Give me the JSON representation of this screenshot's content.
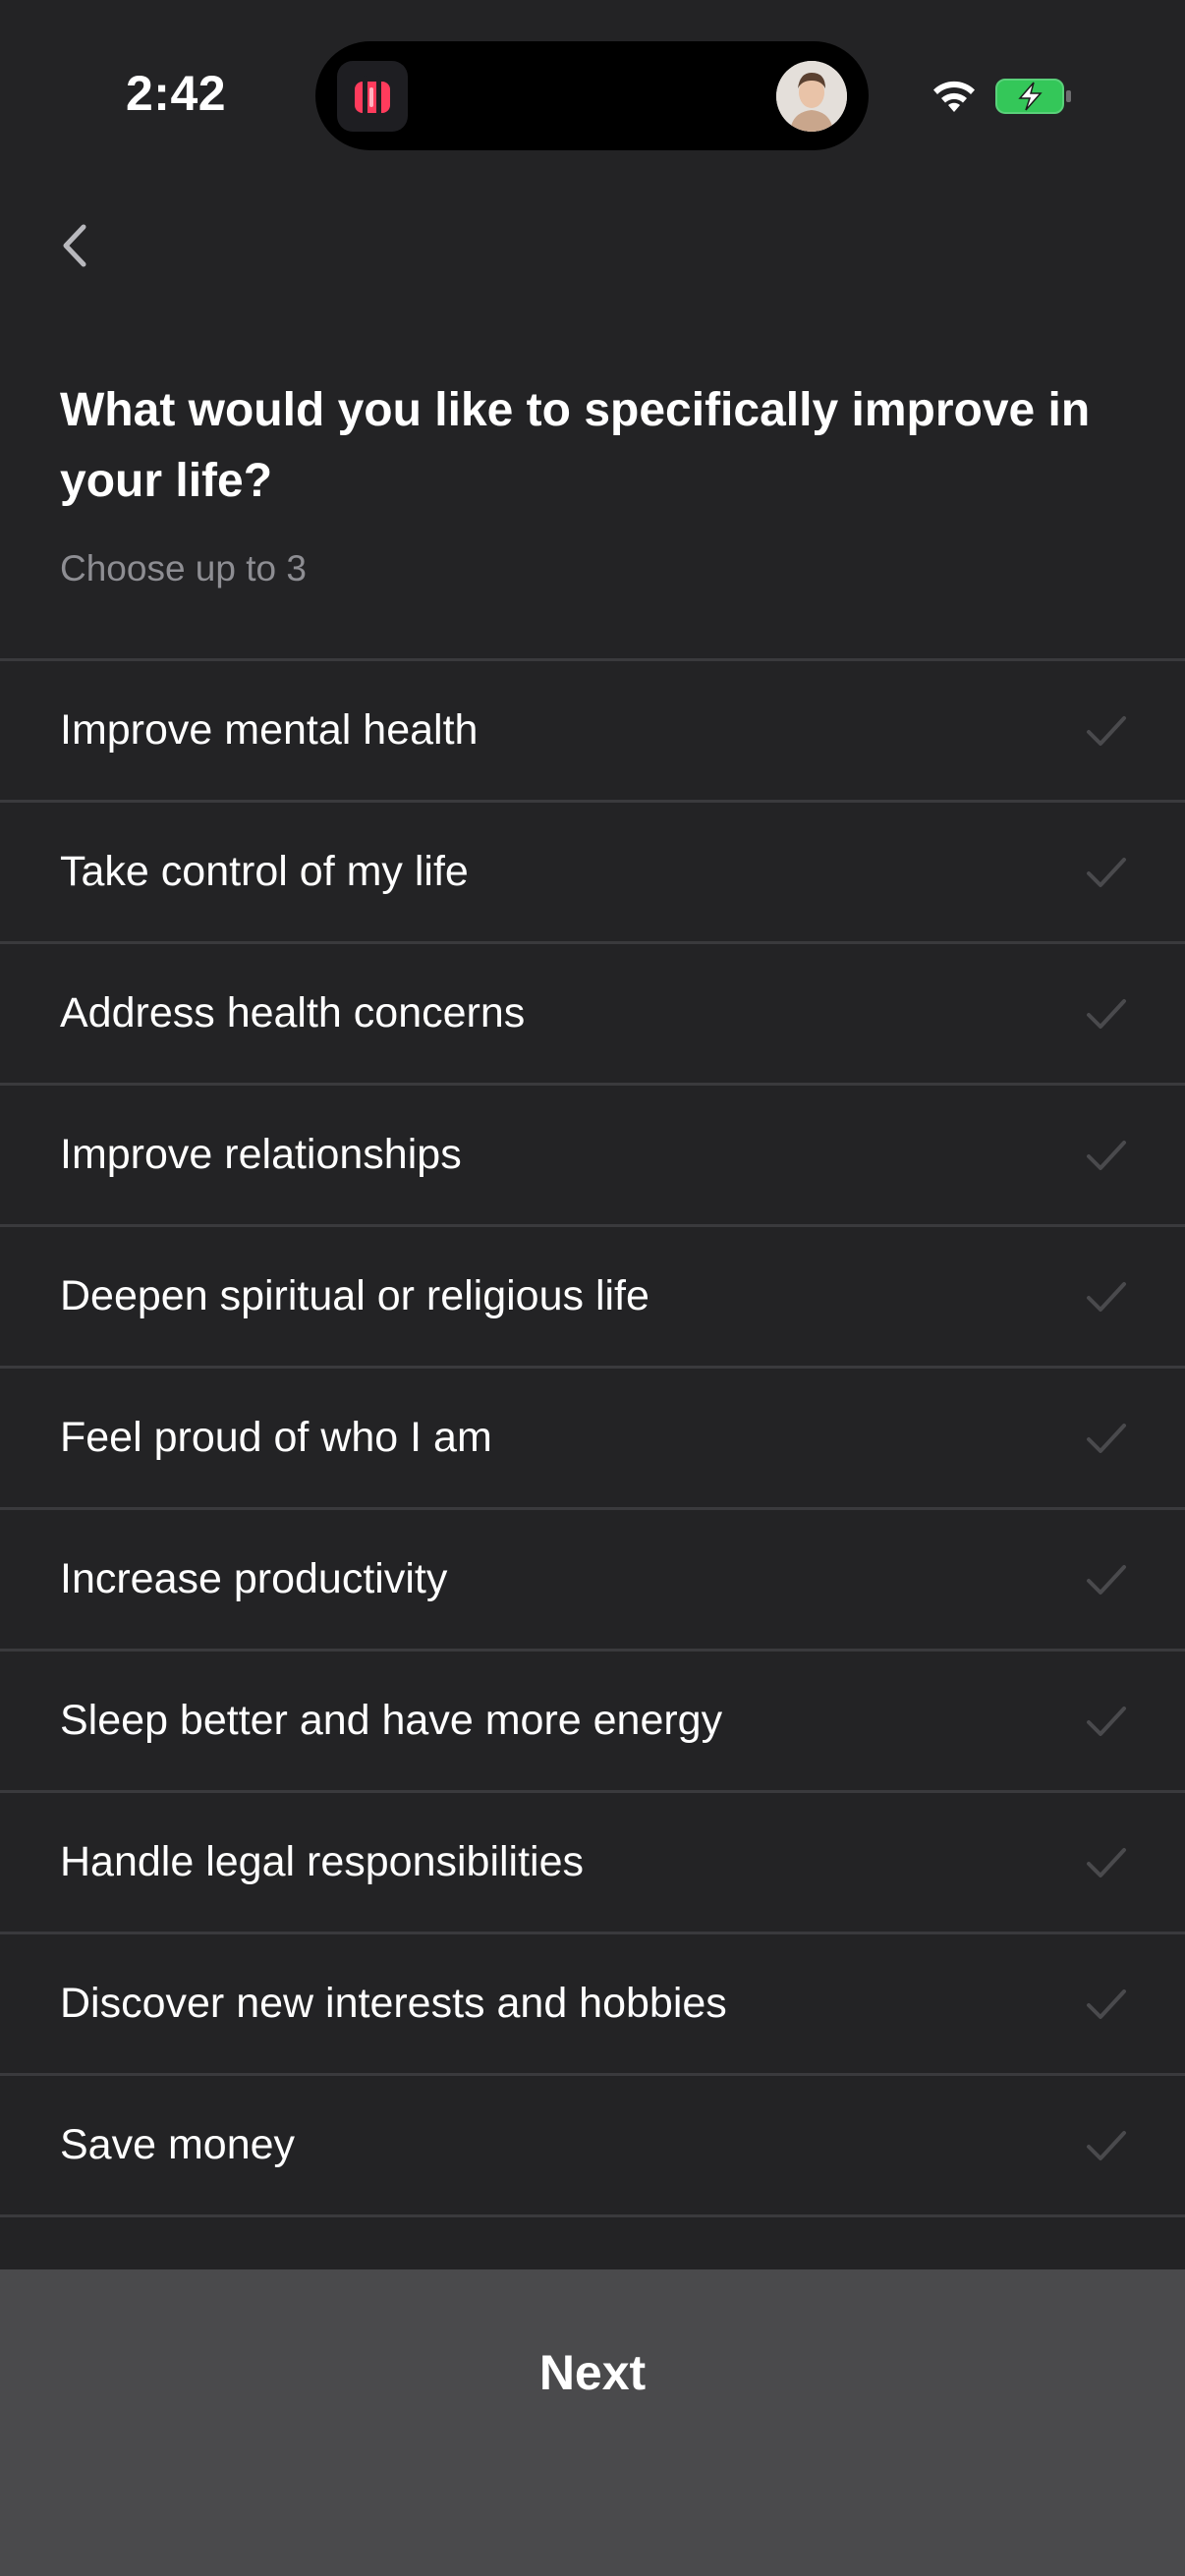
{
  "status_bar": {
    "time": "2:42"
  },
  "header": {
    "title": "What would you like to specifically improve in your life?",
    "subtitle": "Choose up to 3"
  },
  "options": [
    {
      "label": "Improve mental health"
    },
    {
      "label": "Take control of my life"
    },
    {
      "label": "Address health concerns"
    },
    {
      "label": "Improve relationships"
    },
    {
      "label": "Deepen spiritual or religious life"
    },
    {
      "label": "Feel proud of who I am"
    },
    {
      "label": "Increase productivity"
    },
    {
      "label": "Sleep better and have more energy"
    },
    {
      "label": "Handle legal responsibilities"
    },
    {
      "label": "Discover new interests and hobbies"
    },
    {
      "label": "Save money"
    }
  ],
  "footer": {
    "next_label": "Next"
  },
  "colors": {
    "background": "#232325",
    "divider": "#3a3a3d",
    "muted_text": "#8e8e93",
    "check_unselected": "#4a4a4d",
    "next_button_bg": "#4a4a4c",
    "battery_green": "#34c759",
    "app_icon_accent": "#ff3b5c"
  },
  "icons": {
    "back": "chevron-left-icon",
    "check": "checkmark-icon",
    "wifi": "wifi-icon",
    "battery": "battery-charging-icon"
  }
}
